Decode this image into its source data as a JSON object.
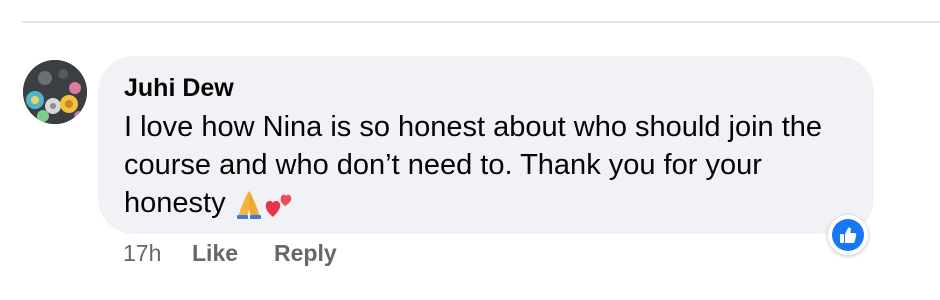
{
  "comment": {
    "author": "Juhi Dew",
    "text": "I love how Nina is so honest about who should join the course and who don’t need to. Thank you for your honesty",
    "emojis": [
      "folded-hands",
      "two-hearts"
    ],
    "reaction": "like",
    "timestamp": "17h",
    "like_label": "Like",
    "reply_label": "Reply"
  },
  "colors": {
    "bubble": "#f0f2f5",
    "text": "#050505",
    "meta": "#65676b",
    "accent": "#1877f2"
  }
}
